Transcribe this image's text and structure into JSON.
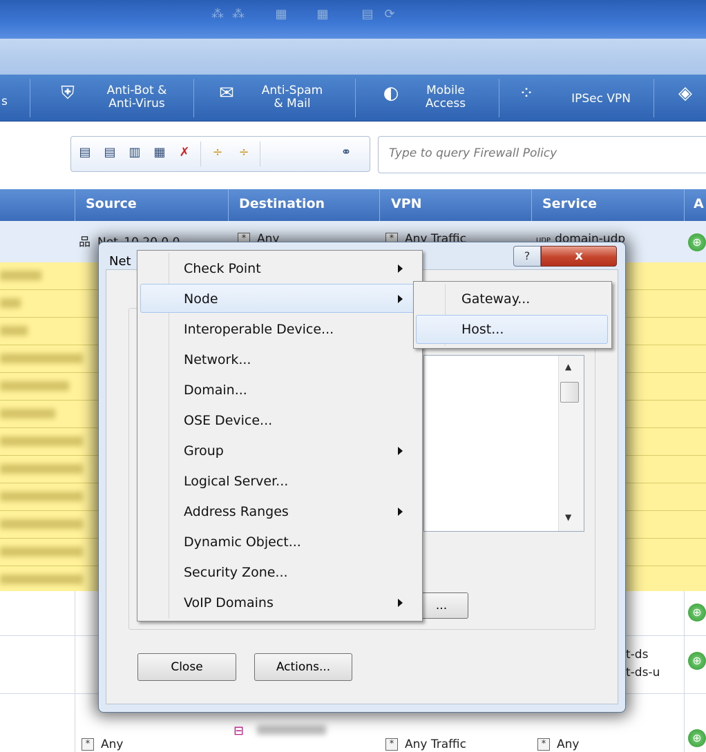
{
  "ribbon": {
    "tabs": [
      {
        "label_l1": "s",
        "label_l2": ""
      },
      {
        "label_l1": "Anti-Bot &",
        "label_l2": "Anti-Virus"
      },
      {
        "label_l1": "Anti-Spam",
        "label_l2": "& Mail"
      },
      {
        "label_l1": "Mobile",
        "label_l2": "Access"
      },
      {
        "label_l1": "IPSec VPN",
        "label_l2": ""
      }
    ]
  },
  "search": {
    "placeholder": "Type to query Firewall Policy"
  },
  "table": {
    "headers": [
      "Source",
      "Destination",
      "VPN",
      "Service",
      "A"
    ],
    "row1": {
      "source": "Net_10.20.0.0",
      "destination": "Any",
      "vpn": "Any Traffic",
      "service_prefix": "UDP",
      "service": "domain-udp"
    },
    "row_partial": {
      "service_l1": "t-ds",
      "service_l2": "t-ds-u"
    },
    "row_bottom": {
      "source": "Any",
      "vpn": "Any Traffic",
      "service": "Any"
    }
  },
  "dialog": {
    "title_partial": "Net",
    "help_label": "?",
    "close_label": "x",
    "browse_label": "...",
    "close_button": "Close",
    "actions_button": "Actions..."
  },
  "context_menu": {
    "items": [
      {
        "label": "Check Point",
        "submenu": true
      },
      {
        "label": "Node",
        "submenu": true
      },
      {
        "label": "Interoperable Device...",
        "submenu": false
      },
      {
        "label": "Network...",
        "submenu": false
      },
      {
        "label": "Domain...",
        "submenu": false
      },
      {
        "label": "OSE Device...",
        "submenu": false
      },
      {
        "label": "Group",
        "submenu": true
      },
      {
        "label": "Logical Server...",
        "submenu": false
      },
      {
        "label": "Address Ranges",
        "submenu": true
      },
      {
        "label": "Dynamic Object...",
        "submenu": false
      },
      {
        "label": "Security Zone...",
        "submenu": false
      },
      {
        "label": "VoIP Domains",
        "submenu": true
      }
    ]
  },
  "submenu": {
    "items": [
      {
        "label": "Gateway..."
      },
      {
        "label": "Host..."
      }
    ]
  },
  "colors": {
    "accent": "#3c6dbb",
    "highlight_row": "#fff29a",
    "menu_bg": "#f0f0f0"
  }
}
